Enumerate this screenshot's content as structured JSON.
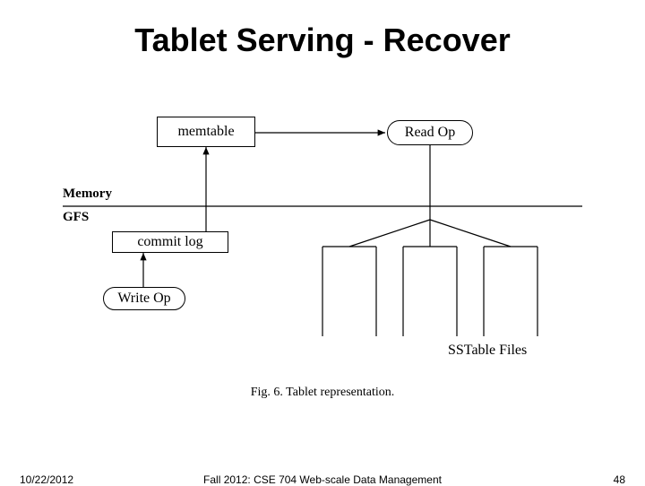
{
  "title": "Tablet Serving - Recover",
  "diagram": {
    "memtable": "memtable",
    "read_op": "Read Op",
    "memory_label": "Memory",
    "gfs_label": "GFS",
    "commit_log": "commit log",
    "write_op": "Write Op",
    "sstable_label": "SSTable Files",
    "caption": "Fig. 6.   Tablet representation."
  },
  "footer": {
    "date": "10/22/2012",
    "course": "Fall 2012: CSE 704 Web-scale Data Management",
    "page": "48"
  }
}
